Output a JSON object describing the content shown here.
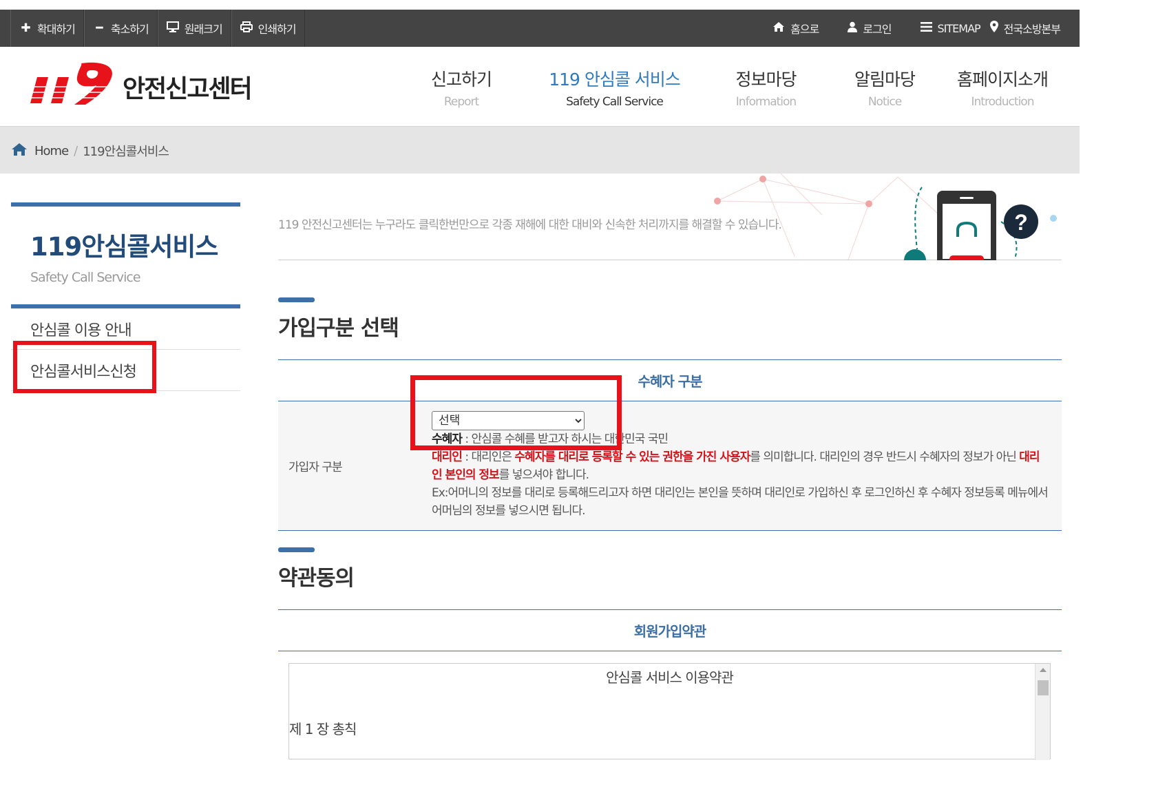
{
  "toolbar": {
    "tools": [
      {
        "icon": "plus-icon",
        "glyph": "✚",
        "label": "확대하기"
      },
      {
        "icon": "minus-icon",
        "glyph": "━",
        "label": "축소하기"
      },
      {
        "icon": "monitor-icon",
        "glyph": "🖵",
        "label": "원래크기"
      },
      {
        "icon": "printer-icon",
        "glyph": "⎙",
        "label": "인쇄하기"
      }
    ],
    "links": [
      {
        "icon": "home-icon",
        "glyph": "⌂",
        "label": "홈으로"
      },
      {
        "icon": "user-icon",
        "glyph": "👤",
        "label": "로그인"
      },
      {
        "icon": "menu-icon",
        "glyph": "☰",
        "label": "SITEMAP"
      },
      {
        "icon": "location-pin-icon",
        "glyph": "⚲",
        "label": "전국소방본부"
      }
    ]
  },
  "header": {
    "logo_text": "안전신고센터",
    "logo_number": "119",
    "nav": [
      {
        "ko": "신고하기",
        "en": "Report"
      },
      {
        "ko": "119 안심콜 서비스",
        "en": "Safety Call Service"
      },
      {
        "ko": "정보마당",
        "en": "Information"
      },
      {
        "ko": "알림마당",
        "en": "Notice"
      },
      {
        "ko": "홈페이지소개",
        "en": "Introduction"
      }
    ]
  },
  "breadcrumb": {
    "home": "Home",
    "separator": "/",
    "current": "119안심콜서비스"
  },
  "sidebar": {
    "title": "119안심콜서비스",
    "subtitle": "Safety Call Service",
    "items": [
      {
        "label": "안심콜 이용 안내"
      },
      {
        "label": "안심콜서비스신청"
      }
    ]
  },
  "intro": {
    "text": "119 안전신고센터는 누구라도 클릭한번만으로 각종 재해에 대한 대비와 신속한 처리까지를 해결할 수 있습니다."
  },
  "section1": {
    "title": "가입구분 선택",
    "table_header": "수혜자 구분",
    "row_label": "가입자 구분",
    "select_value": "선택",
    "line1_bold": "수혜자",
    "line1_rest": " : 안심콜 수혜를 받고자 하시는 대한민국 국민",
    "line2_bold": "대리인",
    "line2_mid": " : 대리인은 ",
    "line2_red": "수혜자를 대리로 등록할 수 있는 권한을 가진 사용자",
    "line2_rest": "를 의미합니다. 대리인의 경우 반드시 수혜자의 정보가 아닌 ",
    "line3_red": "대리인 본인의 정보",
    "line3_rest": "를 넣으셔야 합니다.",
    "line4": "Ex:어머니의 정보를 대리로 등록해드리고자 하면 대리인는 본인을 뜻하며 대리인로 가입하신 후 로그인하신 후 수혜자 정보등록 메뉴에서 어머님의 정보를 넣으시면 됩니다."
  },
  "section2": {
    "title": "약관동의",
    "table_header": "회원가입약관",
    "terms_title": "안심콜 서비스 이용약관",
    "terms_chapter": "제 1 장 총칙"
  },
  "colors": {
    "accent": "#3d6fa8",
    "highlight": "#e8121a",
    "brand_red": "#e8121a",
    "topbar": "#444444"
  }
}
